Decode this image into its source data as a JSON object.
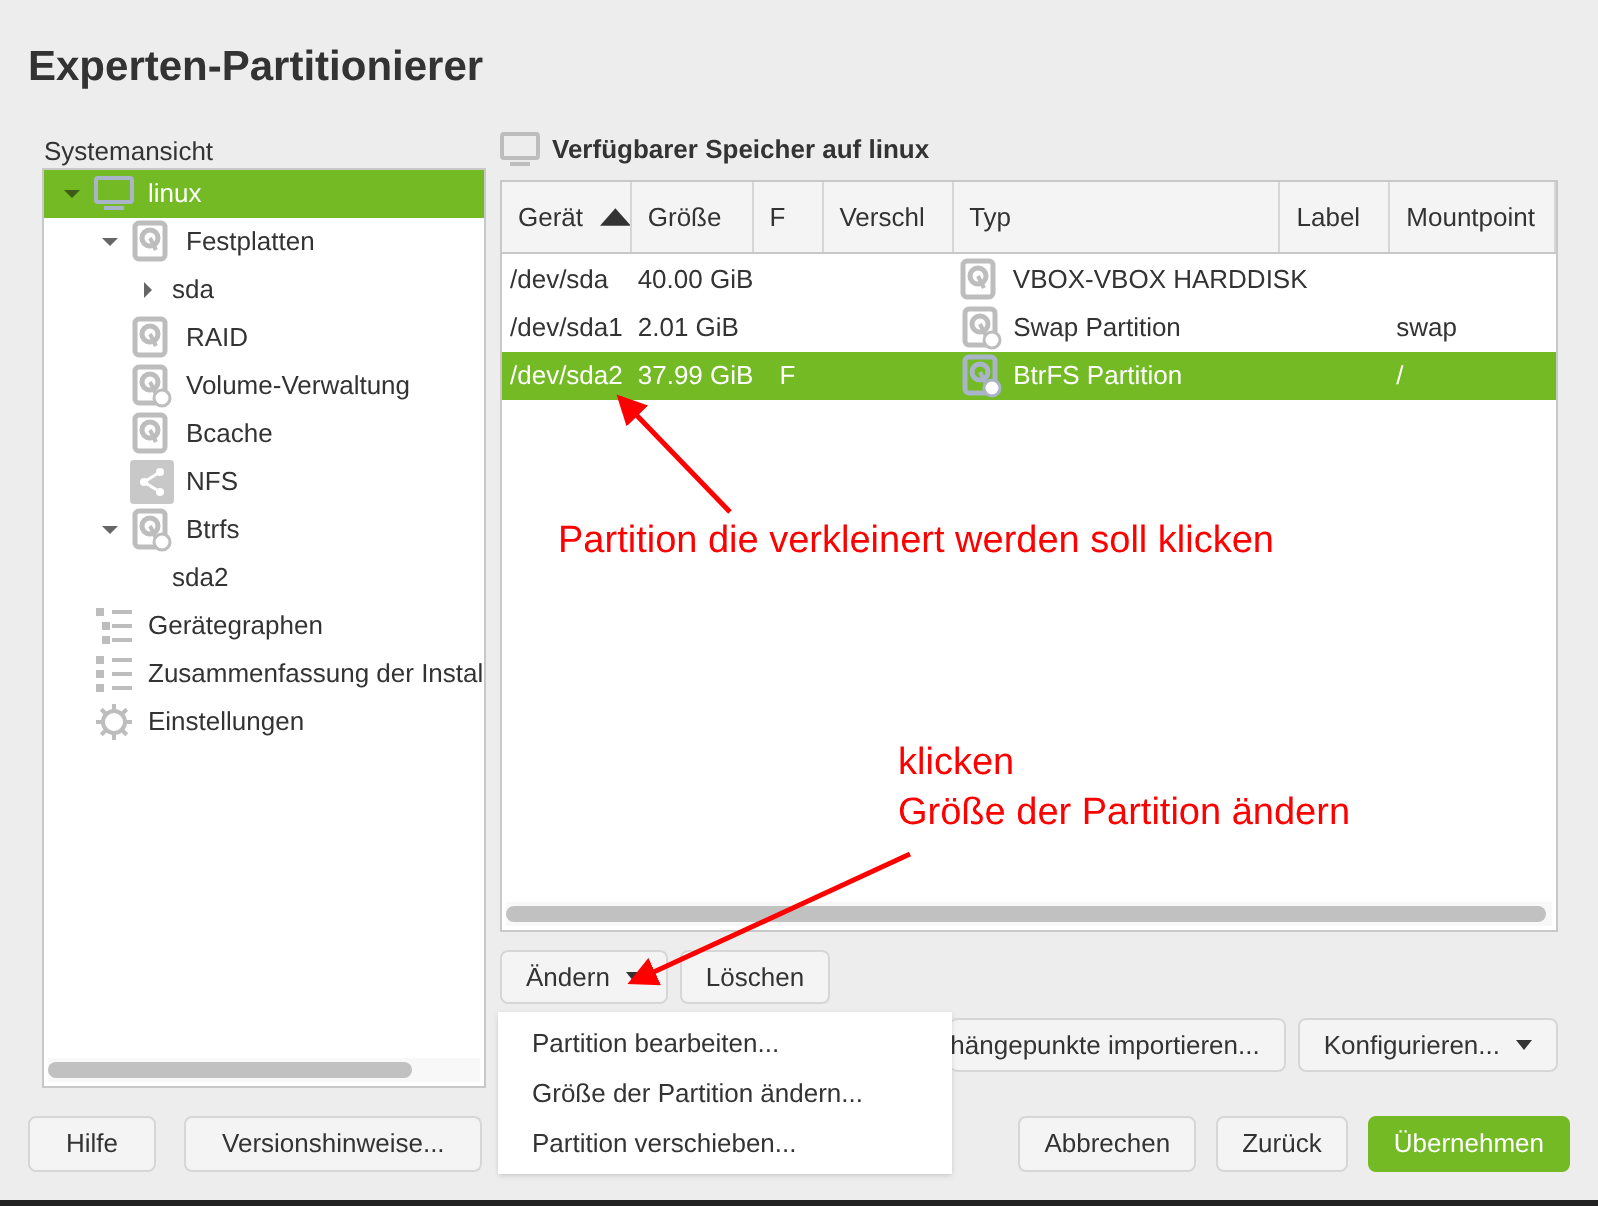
{
  "window": {
    "title": "Experten-Partitionierer"
  },
  "sidebar": {
    "label": "Systemansicht",
    "tree": [
      {
        "label": "linux",
        "kind": "computer",
        "expanded": true,
        "selected": true,
        "children": [
          {
            "label": "Festplatten",
            "kind": "disk",
            "expanded": true,
            "selected": false,
            "children": [
              {
                "label": "sda",
                "expanded": false,
                "selected": false
              }
            ]
          },
          {
            "label": "RAID",
            "kind": "disk",
            "selected": false
          },
          {
            "label": "Volume-Verwaltung",
            "kind": "disk-clock",
            "selected": false
          },
          {
            "label": "Bcache",
            "kind": "disk",
            "selected": false
          },
          {
            "label": "NFS",
            "kind": "share",
            "selected": false
          },
          {
            "label": "Btrfs",
            "kind": "disk-clock",
            "expanded": true,
            "selected": false,
            "children": [
              {
                "label": "sda2",
                "selected": false
              }
            ]
          }
        ]
      },
      {
        "label": "Gerätegraphen",
        "kind": "graph",
        "selected": false
      },
      {
        "label": "Zusammenfassung der Instal",
        "kind": "list",
        "selected": false
      },
      {
        "label": "Einstellungen",
        "kind": "gear",
        "selected": false
      }
    ]
  },
  "main": {
    "heading": "Verfügbarer Speicher auf linux",
    "table": {
      "columns": [
        {
          "label": "Gerät",
          "sorted": true
        },
        {
          "label": "Größe",
          "sorted": false
        },
        {
          "label": "F",
          "sorted": false
        },
        {
          "label": "Verschl",
          "sorted": false
        },
        {
          "label": "Typ",
          "sorted": false
        },
        {
          "label": "Label",
          "sorted": false
        },
        {
          "label": "Mountpoint",
          "sorted": false
        }
      ],
      "rows": [
        {
          "device": "/dev/sda",
          "size": "40.00 GiB",
          "f": "",
          "type": "VBOX-VBOX HARDDISK",
          "kind": "disk",
          "mount": "",
          "selected": false
        },
        {
          "device": "/dev/sda1",
          "size": "2.01 GiB",
          "f": "",
          "type": "Swap Partition",
          "kind": "disk-clock",
          "mount": "swap",
          "selected": false
        },
        {
          "device": "/dev/sda2",
          "size": "37.99 GiB",
          "f": "F",
          "type": "BtrFS Partition",
          "kind": "disk-clock",
          "mount": "/",
          "selected": true
        }
      ]
    },
    "buttons": [
      {
        "label": "Ändern",
        "menu": true
      },
      {
        "label": "Löschen",
        "menu": false
      }
    ],
    "buttons_row2": [
      {
        "label": "hängepunkte importieren...",
        "menu": false
      },
      {
        "label": "Konfigurieren...",
        "menu": true
      }
    ],
    "popup_menu": [
      "Partition bearbeiten...",
      "Größe der Partition ändern...",
      "Partition verschieben..."
    ]
  },
  "footer": {
    "left_buttons": [
      "Hilfe",
      "Versionshinweise..."
    ],
    "right_buttons": [
      {
        "label": "Abbrechen",
        "primary": false
      },
      {
        "label": "Zurück",
        "primary": false
      },
      {
        "label": "Übernehmen",
        "primary": true
      }
    ]
  },
  "annotations": [
    {
      "lines": [
        "Partition die verkleinert werden soll klicken"
      ]
    },
    {
      "lines": [
        "klicken",
        "Größe der Partition ändern"
      ]
    }
  ]
}
